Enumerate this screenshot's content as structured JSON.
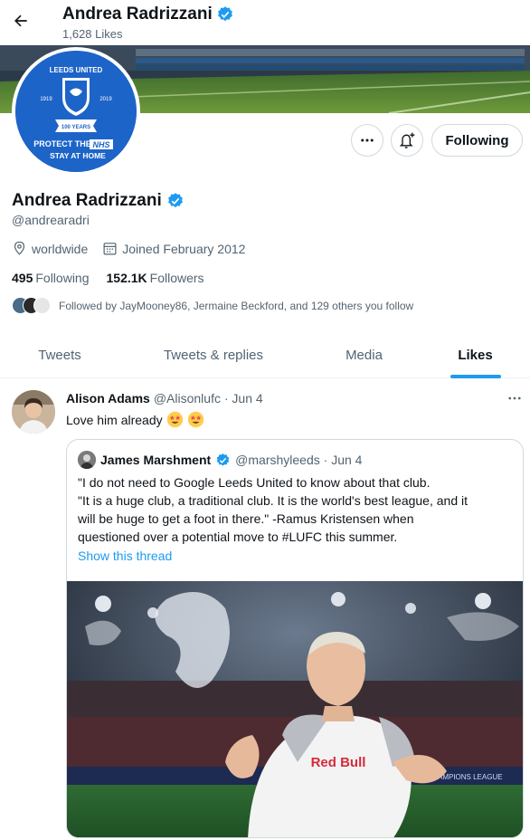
{
  "header": {
    "title": "Andrea Radrizzani",
    "subtitle": "1,628 Likes"
  },
  "avatar": {
    "badge_top": "LEEDS UNITED",
    "year_left": "1919",
    "year_right": "2019",
    "badge_ribbon": "100 YEARS",
    "protect_line": "PROTECT THE",
    "nhs": "NHS",
    "stay_line": "STAY AT HOME"
  },
  "actions": {
    "follow_label": "Following"
  },
  "profile": {
    "name": "Andrea Radrizzani",
    "handle": "@andrearadri",
    "location": "worldwide",
    "joined": "Joined February 2012",
    "following_count": "495",
    "following_label": "Following",
    "followers_count": "152.1K",
    "followers_label": "Followers",
    "followed_by": "Followed by JayMooney86, Jermaine Beckford, and 129 others you follow"
  },
  "tabs": [
    {
      "label": "Tweets",
      "active": false
    },
    {
      "label": "Tweets & replies",
      "active": false
    },
    {
      "label": "Media",
      "active": false
    },
    {
      "label": "Likes",
      "active": true
    }
  ],
  "tweet": {
    "author": "Alison Adams",
    "meta": "@Alisonlufc · Jun 4",
    "text": "Love him already",
    "quote": {
      "author": "James Marshment",
      "meta": "@marshyleeds · Jun 4",
      "lines": [
        "\"I do not need to Google Leeds United to know about that club.",
        "\"It is a huge club, a traditional club. It is the world's best league, and it",
        "will be huge to get a foot in there.\"  -Ramus Kristensen when",
        "questioned over a potential move to #LUFC this summer."
      ],
      "link": "Show this thread",
      "media_text": {
        "shirt_sponsor": "Red Bull",
        "board": "CHAMPIONS LEAGUE"
      }
    }
  },
  "colors": {
    "accent": "#1d9bf0",
    "verified": "#1d9bf0",
    "text": "#0f1419",
    "muted": "#536471",
    "badge_blue": "#1d64c8"
  }
}
